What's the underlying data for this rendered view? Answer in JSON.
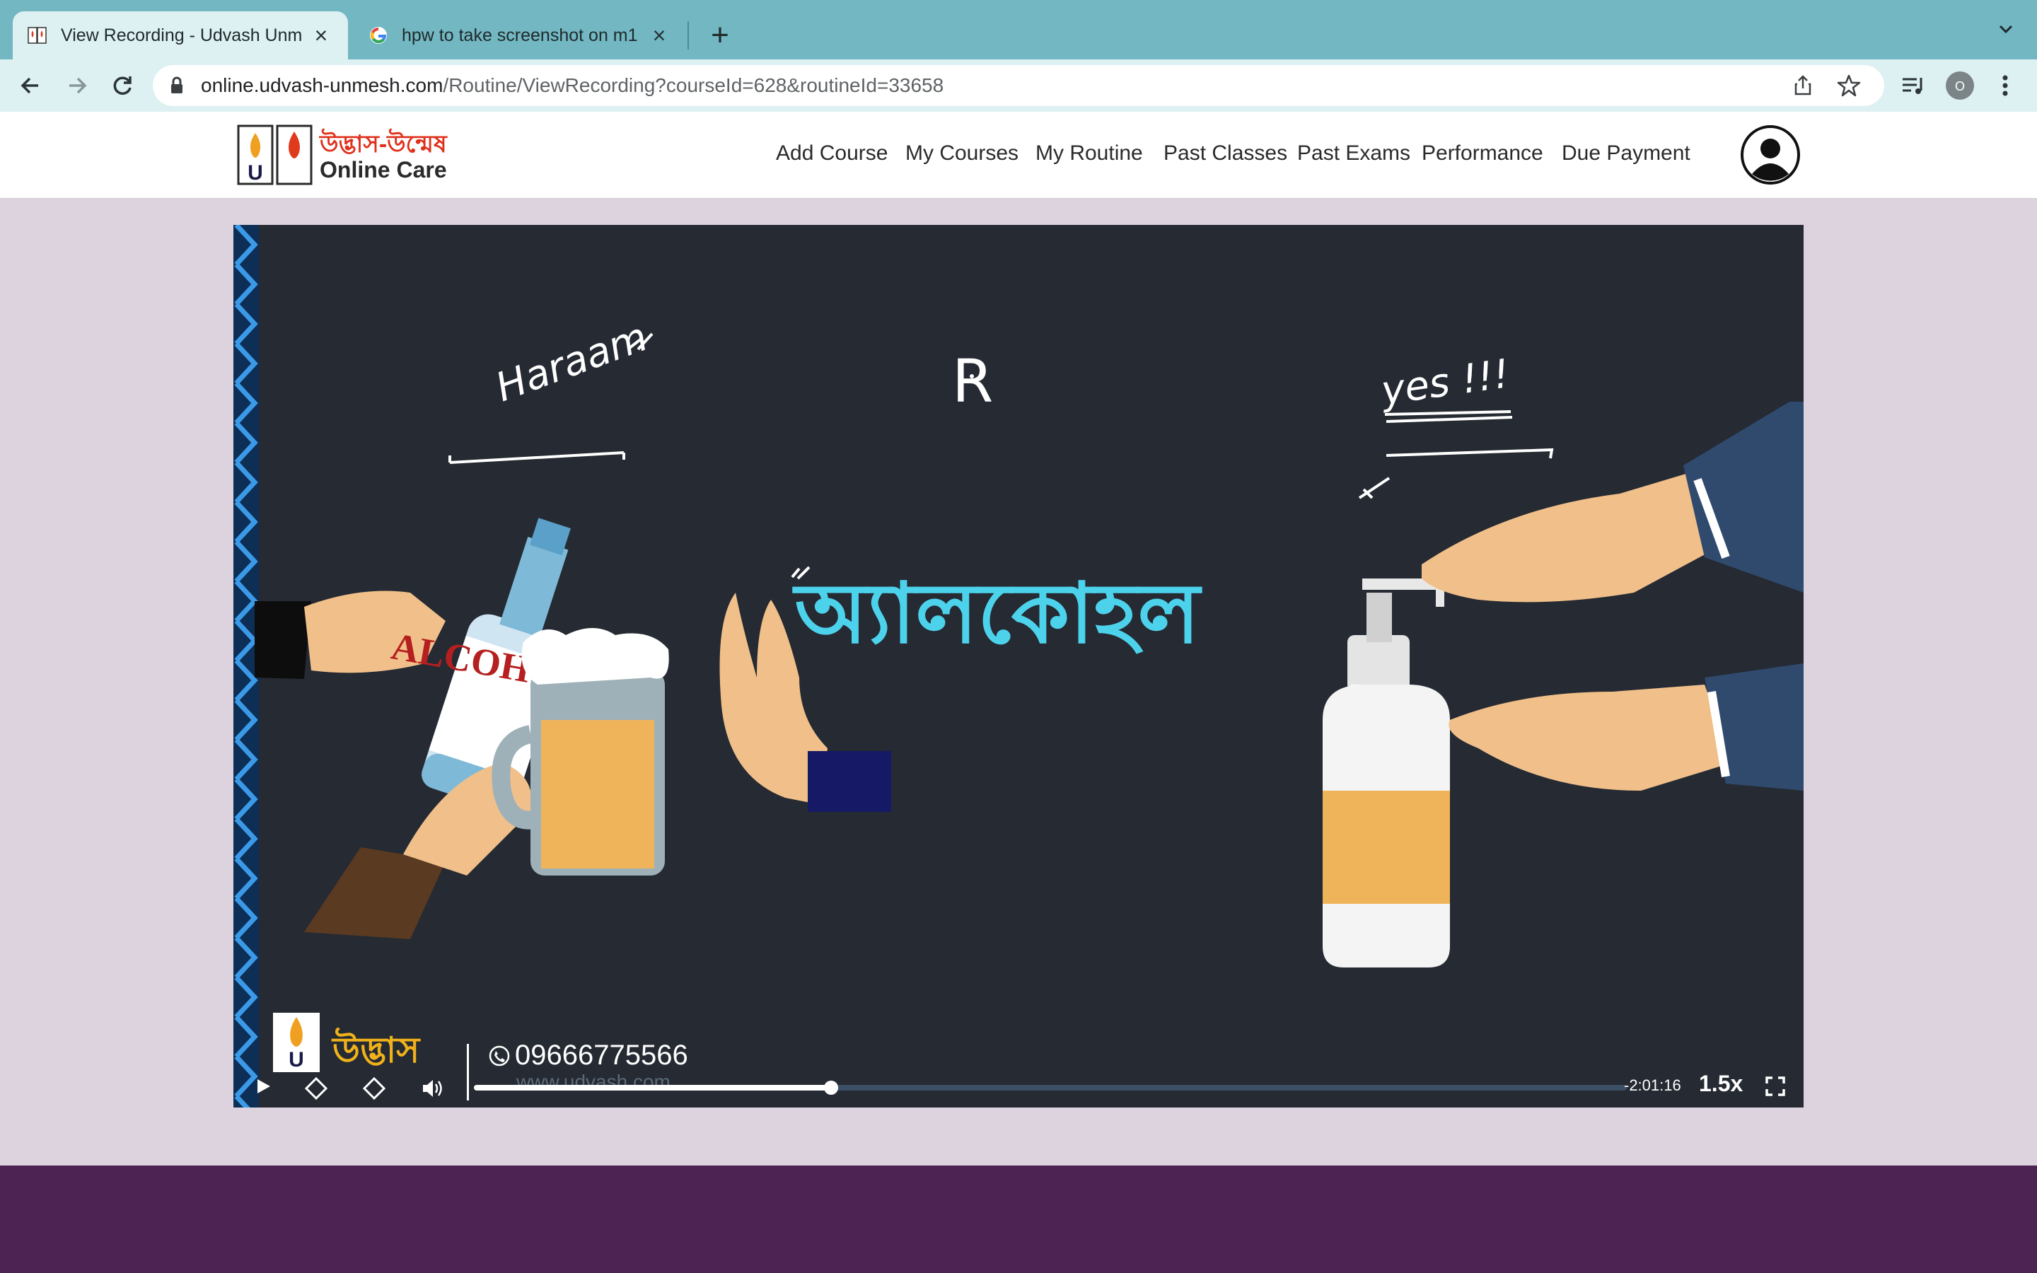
{
  "browser": {
    "tabs": [
      {
        "title": "View Recording - Udvash Unm",
        "active": true
      },
      {
        "title": "hpw to take screenshot on m1 ",
        "active": false
      }
    ],
    "url_host": "online.udvash-unmesh.com",
    "url_path": "/Routine/ViewRecording?courseId=628&routineId=33658",
    "profile_initial": "O"
  },
  "site": {
    "logo_bn": "উদ্ভাস-উন্মেষ",
    "logo_en": "Online Care",
    "nav": [
      "Add Course",
      "My Courses",
      "My Routine",
      "Past Classes",
      "Past Exams",
      "Performance",
      "Due Payment"
    ]
  },
  "video": {
    "annotations": {
      "haraam": "Haraam",
      "r": "R",
      "yes": "yes !!!",
      "alcohol_bn": "অ্যালকোহল",
      "bottle_label": "ALCOHOL"
    },
    "brand_bn": "উদ্ভাস",
    "phone": "09666775566",
    "website": "www.udvash.com",
    "time_remaining": "-2:01:16",
    "speed": "1.5x",
    "progress": 0.31,
    "colors": {
      "title_text": "#4dd2ec",
      "board": "#252a33",
      "skin": "#f1c08a",
      "beer": "#efb45a"
    }
  },
  "icons": [
    "back-icon",
    "forward-icon",
    "reload-icon",
    "lock-icon",
    "share-icon",
    "star-icon",
    "media-icon",
    "menu-icon",
    "avatar-icon",
    "play-icon",
    "volume-icon",
    "fullscreen-icon",
    "phone-icon"
  ]
}
